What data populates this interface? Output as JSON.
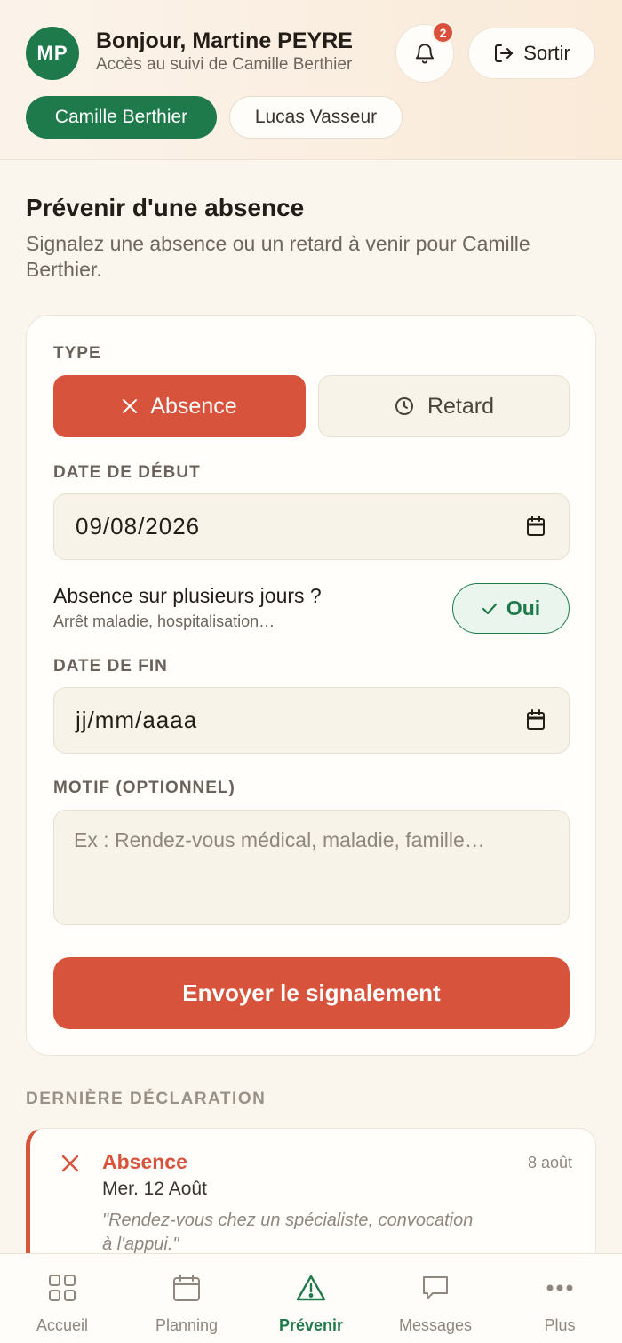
{
  "header": {
    "avatar_initials": "MP",
    "greeting": "Bonjour, Martine PEYRE",
    "access_text": "Accès au suivi de Camille Berthier",
    "notification_count": "2",
    "logout_label": "Sortir",
    "children": [
      {
        "name": "Camille Berthier",
        "active": true
      },
      {
        "name": "Lucas Vasseur",
        "active": false
      }
    ]
  },
  "page": {
    "title": "Prévenir d'une absence",
    "subtitle": "Signalez une absence ou un retard à venir pour Camille Berthier."
  },
  "form": {
    "type_label": "TYPE",
    "type_options": [
      "Absence",
      "Retard"
    ],
    "selected_type": "Absence",
    "start_date_label": "DATE DE DÉBUT",
    "start_date_value": "09/08/2026",
    "multi_day_question": "Absence sur plusieurs jours ?",
    "multi_day_hint": "Arrêt maladie, hospitalisation…",
    "multi_day_toggle": "Oui",
    "end_date_label": "DATE DE FIN",
    "end_date_placeholder": "jj/mm/aaaa",
    "reason_label": "MOTIF (OPTIONNEL)",
    "reason_placeholder": "Ex : Rendez-vous médical, maladie, famille…",
    "submit_label": "Envoyer le signalement"
  },
  "last_declaration": {
    "section_label": "DERNIÈRE DÉCLARATION",
    "type": "Absence",
    "date": "Mer. 12 Août",
    "declared_on": "8 août",
    "quote": "\"Rendez-vous chez un spécialiste, convocation à l'appui.\""
  },
  "nav": {
    "items": [
      {
        "label": "Accueil",
        "icon": "grid-icon"
      },
      {
        "label": "Planning",
        "icon": "calendar-icon"
      },
      {
        "label": "Prévenir",
        "icon": "warning-icon",
        "active": true
      },
      {
        "label": "Messages",
        "icon": "message-icon"
      },
      {
        "label": "Plus",
        "icon": "more-icon"
      }
    ]
  },
  "colors": {
    "brand_green": "#1e7a4a",
    "accent_red": "#d7533c",
    "background": "#faf6ee"
  }
}
